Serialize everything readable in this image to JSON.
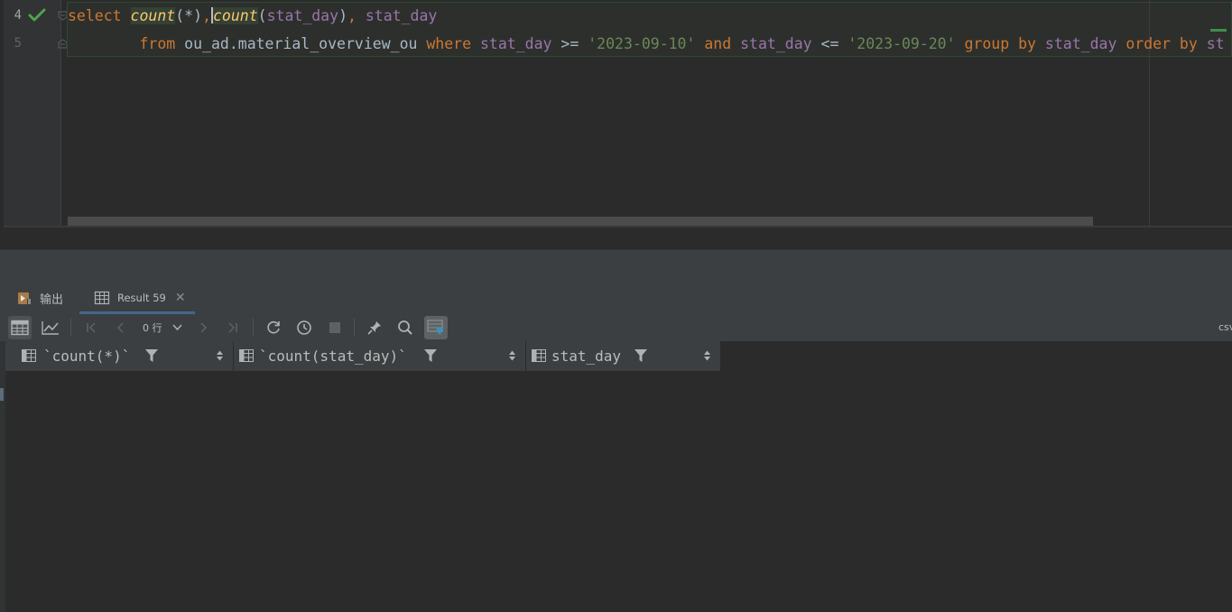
{
  "editor": {
    "line_numbers": [
      "4",
      "5"
    ],
    "line1": {
      "kw_select": "select ",
      "fn_count1": "count",
      "paren1": "(*)",
      "comma1": ",",
      "fn_count2": "count",
      "paren2_open": "(",
      "col_stat_day_a": "stat_day",
      "paren2_close": ")",
      "comma2": ", ",
      "col_stat_day_b": "stat_day"
    },
    "line2": {
      "indent": "        ",
      "kw_from": "from ",
      "table": "ou_ad.material_overview_ou ",
      "kw_where": "where ",
      "col_a": "stat_day",
      "op_ge": " >= ",
      "str_start": "'2023-09-10'",
      "kw_and": " and ",
      "col_b": "stat_day",
      "op_le": " <= ",
      "str_end": "'2023-09-20'",
      "kw_group": " group by ",
      "col_c": "stat_day",
      "kw_order": " order by ",
      "col_d": "st"
    }
  },
  "tool_window": {
    "tabs": [
      {
        "label": "输出",
        "icon": "output-icon"
      },
      {
        "label": "Result 59",
        "icon": "table-icon",
        "close": "✕"
      }
    ]
  },
  "toolbar": {
    "rows_label": "0 行",
    "export_label": "csv"
  },
  "grid": {
    "columns": [
      "`count(*)`",
      "`count(stat_day)`",
      "stat_day"
    ]
  },
  "colors": {
    "keyword": "#cc7832",
    "function": "#ffc66d",
    "column": "#9876aa",
    "string": "#6a8759",
    "success": "#4ea34e"
  }
}
